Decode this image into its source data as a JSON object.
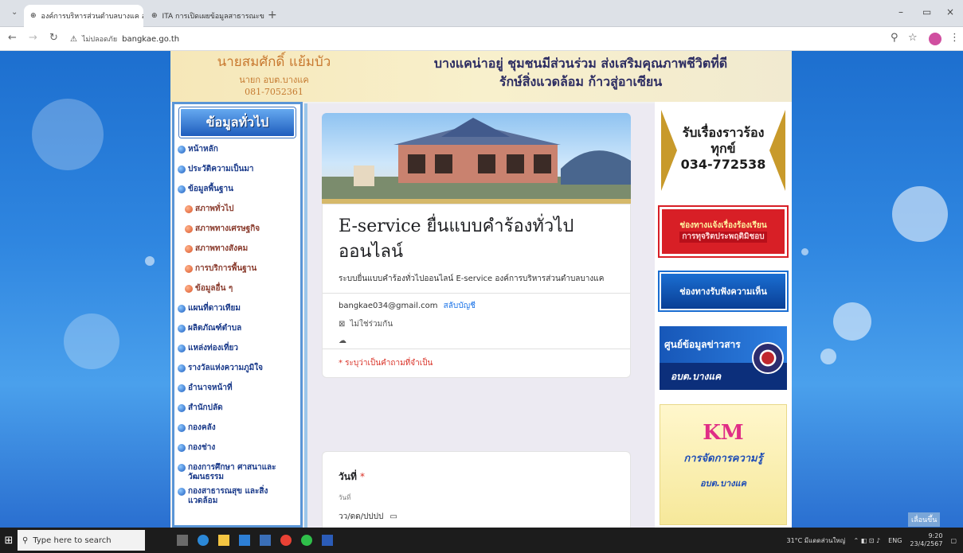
{
  "browser": {
    "tabs": [
      {
        "title": "องค์การบริหารส่วนตำบลบางแค อ.อ...",
        "active": true
      },
      {
        "title": "ITA การเปิดเผยข้อมูลสาธารณะของหน่วยงาน",
        "active": false
      }
    ],
    "security_label": "ไม่ปลอดภัย",
    "url": "bangkae.go.th"
  },
  "site_header": {
    "mayor_name": "นายสมศักดิ์ แย้มบัว",
    "mayor_role": "นายก อบต.บางแค",
    "mayor_phone": "081-7052361",
    "slogan_line1": "บางแคน่าอยู่ ชุมชนมีส่วนร่วม ส่งเสริมคุณภาพชีวิตที่ดี",
    "slogan_line2": "รักษ์สิ่งแวดล้อม ก้าวสู่อาเซียน"
  },
  "sidebar": {
    "title": "ข้อมูลทั่วไป",
    "items": [
      {
        "label": "หน้าหลัก",
        "sub": false
      },
      {
        "label": "ประวัติความเป็นมา",
        "sub": false
      },
      {
        "label": "ข้อมูลพื้นฐาน",
        "sub": false
      },
      {
        "label": "สภาพทั่วไป",
        "sub": true
      },
      {
        "label": "สภาพทางเศรษฐกิจ",
        "sub": true
      },
      {
        "label": "สภาพทางสังคม",
        "sub": true
      },
      {
        "label": "การบริการพื้นฐาน",
        "sub": true
      },
      {
        "label": "ข้อมูลอื่น ๆ",
        "sub": true
      },
      {
        "label": "แผนที่ดาวเทียม",
        "sub": false
      },
      {
        "label": "ผลิตภัณฑ์ตำบล",
        "sub": false
      },
      {
        "label": "แหล่งท่องเที่ยว",
        "sub": false
      },
      {
        "label": "รางวัลแห่งความภูมิใจ",
        "sub": false
      },
      {
        "label": "อำนาจหน้าที่",
        "sub": false
      },
      {
        "label": "สำนักปลัด",
        "sub": false
      },
      {
        "label": "กองคลัง",
        "sub": false
      },
      {
        "label": "กองช่าง",
        "sub": false
      },
      {
        "label": "กองการศึกษา ศาสนาและวัฒนธรรม",
        "sub": false
      },
      {
        "label": "กองสาธารณสุข และสิ่งแวดล้อม",
        "sub": false
      }
    ]
  },
  "form": {
    "title": "E-service ยื่นแบบคำร้องทั่วไปออนไลน์",
    "description": "ระบบยื่นแบบคำร้องทั่วไปออนไลน์ E-service องค์การบริหารส่วนตำบลบางแค",
    "account_email": "bangkae034@gmail.com",
    "switch_account": "สลับบัญชี",
    "not_shared": "ไม่ใช่ร่วมกัน",
    "required_note": "* ระบุว่าเป็นคำถามที่จำเป็น",
    "question_label": "วันที่",
    "question_required_mark": "*",
    "date_sublabel": "วันที่",
    "date_placeholder": "วว/ดด/ปปปป"
  },
  "right_banners": {
    "complaint_title": "รับเรื่องราวร้องทุกข์",
    "complaint_phone": "034-772538",
    "corruption_line1": "ช่องทางแจ้งเรื่องร้องเรียน",
    "corruption_line2": "การทุจริตประพฤติมิชอบ",
    "opinion": "ช่องทางรับฟังความเห็น",
    "news_line1": "ศูนย์ข้อมูลข่าวสาร",
    "news_line2": "อบต.บางแค",
    "km_title": "KM",
    "km_line1": "การจัดการความรู้",
    "km_line2": "อบต.บางแค"
  },
  "taskbar": {
    "search_placeholder": "Type here to search",
    "weather": "31°C มีแดดส่วนใหญ่",
    "lang": "ENG",
    "time": "9:20",
    "date": "23/4/2567"
  },
  "scroll_top_label": "เลื่อนขึ้น",
  "colors": {
    "page_bg": "#2f86e0",
    "accent": "#1a73e8",
    "required": "#d93025"
  }
}
